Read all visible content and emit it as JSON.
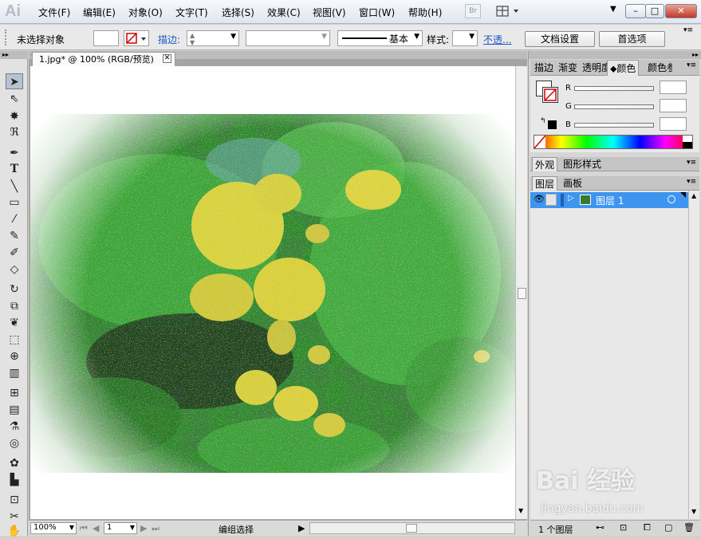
{
  "app": {
    "logo": "Ai",
    "br": "Br"
  },
  "menu": [
    "文件(F)",
    "编辑(E)",
    "对象(O)",
    "文字(T)",
    "选择(S)",
    "效果(C)",
    "视图(V)",
    "窗口(W)",
    "帮助(H)"
  ],
  "options": {
    "selection": "未选择对象",
    "stroke_label": "描边:",
    "stroke_profile": "基本",
    "style_label": "样式:",
    "opacity_label": "不透...",
    "doc_setup": "文档设置",
    "prefs": "首选项"
  },
  "document": {
    "tab_title": "1.jpg* @ 100% (RGB/预览)"
  },
  "status": {
    "zoom": "100%",
    "page": "1",
    "text": "编组选择"
  },
  "color_panel": {
    "tabs": [
      "描边",
      "渐变",
      "透明度",
      "颜色",
      "颜色参考"
    ],
    "active_tab": "颜色",
    "channels": [
      "R",
      "G",
      "B"
    ]
  },
  "appearance_panel": {
    "tabs": [
      "外观",
      "图形样式"
    ]
  },
  "layers_panel": {
    "tabs": [
      "图层",
      "画板"
    ],
    "layers": [
      {
        "name": "图层 1"
      }
    ],
    "footer": "1 个图层"
  },
  "watermark": {
    "brand": "Bai 经验",
    "url": "jingyan.baidu.com"
  },
  "colors": {
    "accent": "#3399ff",
    "layer_selected": "#3d95f0"
  }
}
